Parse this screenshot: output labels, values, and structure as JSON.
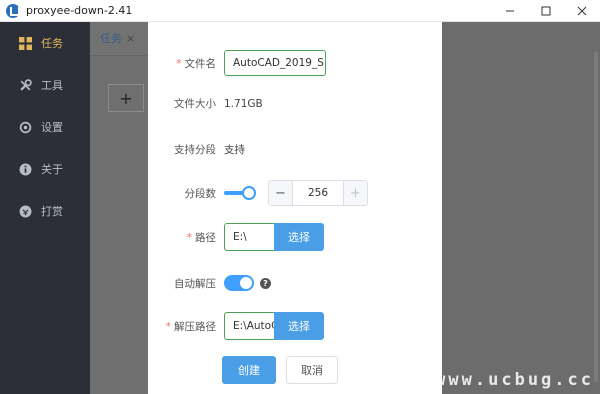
{
  "window": {
    "title": "proxyee-down-2.41"
  },
  "sidebar": {
    "items": [
      {
        "label": "任务",
        "icon": "grid-icon",
        "active": true
      },
      {
        "label": "工具",
        "icon": "wrench-icon",
        "active": false
      },
      {
        "label": "设置",
        "icon": "gear-icon",
        "active": false
      },
      {
        "label": "关于",
        "icon": "info-icon",
        "active": false
      },
      {
        "label": "打赏",
        "icon": "coin-icon",
        "active": false
      }
    ]
  },
  "main": {
    "tab_label": "任务",
    "add_label": "+"
  },
  "dialog": {
    "filename": {
      "label": "文件名",
      "value": "AutoCAD_2019_S"
    },
    "filesize": {
      "label": "文件大小",
      "value": "1.71GB"
    },
    "segment_support": {
      "label": "支持分段",
      "value": "支持"
    },
    "segments": {
      "label": "分段数",
      "value": "256",
      "minus": "−",
      "plus": "+"
    },
    "path": {
      "label": "路径",
      "value": "E:\\",
      "button": "选择"
    },
    "auto_extract": {
      "label": "自动解压",
      "enabled": true,
      "help": "?"
    },
    "extract_path": {
      "label": "解压路径",
      "value": "E:\\AutoCAD",
      "button": "选择"
    },
    "create_button": "创建",
    "cancel_button": "取消"
  },
  "watermark": "www.ucbug.cc",
  "colors": {
    "sidebar_bg": "#2c2f38",
    "accent": "#409eff",
    "active_item": "#e3b45e",
    "primary_button": "#4a9ee6"
  }
}
